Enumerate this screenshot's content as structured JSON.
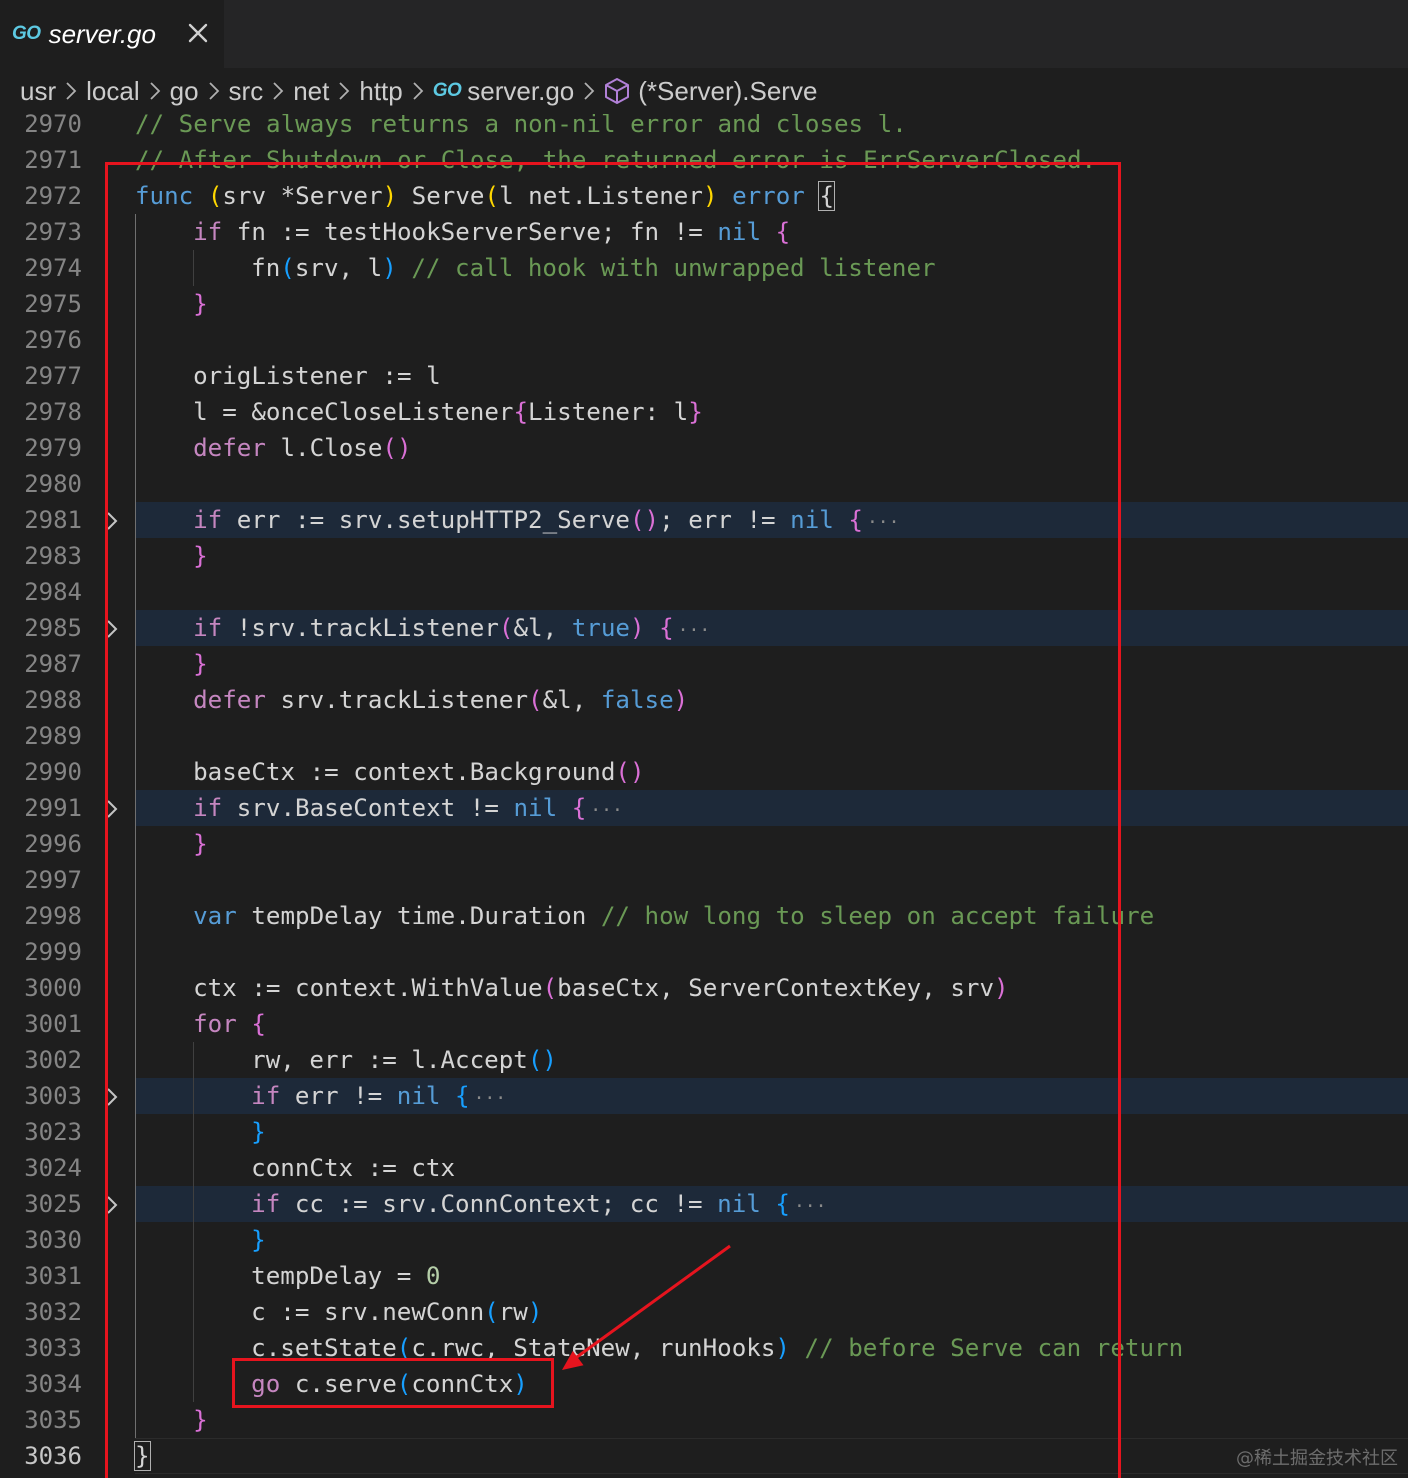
{
  "tab": {
    "badge": "GO",
    "title": "server.go",
    "close_icon": "close-icon"
  },
  "breadcrumb": {
    "segments": [
      "usr",
      "local",
      "go",
      "src",
      "net",
      "http",
      "server.go",
      "(*Server).Serve"
    ],
    "file_badge": "GO",
    "symbol_icon": "cube-method-icon"
  },
  "colors": {
    "comment": "#6a9955",
    "keyword": "#569cd6",
    "control": "#c586c0",
    "function": "#dcdcaa",
    "type": "#4ec9b0",
    "number": "#b5cea8",
    "bracket_1": "#ffd700",
    "bracket_2": "#da70d6",
    "bracket_3": "#179fff",
    "annotation_red": "#e6141e",
    "fold_highlight": "#1d2939"
  },
  "code_lines": [
    {
      "num": "2970",
      "indent": 0,
      "tokens": [
        [
          "// Serve always returns a non-nil error and closes l.",
          "cm"
        ]
      ]
    },
    {
      "num": "2971",
      "indent": 0,
      "tokens": [
        [
          "// After Shutdown or Close, the returned error is ErrServerClosed.",
          "cm"
        ]
      ]
    },
    {
      "num": "2972",
      "indent": 0,
      "tokens": [
        [
          "func",
          "kw"
        ],
        [
          " ",
          ""
        ],
        [
          "(",
          "b1"
        ],
        [
          "srv *Server",
          ""
        ],
        [
          ")",
          "b1"
        ],
        [
          " Serve",
          ""
        ],
        [
          "(",
          "b1"
        ],
        [
          "l net.Listener",
          ""
        ],
        [
          ")",
          "b1"
        ],
        [
          " ",
          ""
        ],
        [
          "error",
          "kw"
        ],
        [
          " ",
          ""
        ],
        [
          "{",
          "bm"
        ]
      ]
    },
    {
      "num": "2973",
      "indent": 1,
      "tokens": [
        [
          "if",
          "ct"
        ],
        [
          " fn := testHookServerServe; fn != ",
          ""
        ],
        [
          "nil",
          "kw"
        ],
        [
          " ",
          ""
        ],
        [
          "{",
          "b2"
        ]
      ]
    },
    {
      "num": "2974",
      "indent": 2,
      "tokens": [
        [
          "fn",
          ""
        ],
        [
          "(",
          "b3"
        ],
        [
          "srv, l",
          ""
        ],
        [
          ")",
          "b3"
        ],
        [
          " ",
          ""
        ],
        [
          "// call hook with unwrapped listener",
          "cm"
        ]
      ]
    },
    {
      "num": "2975",
      "indent": 1,
      "tokens": [
        [
          "}",
          "b2"
        ]
      ]
    },
    {
      "num": "2976",
      "indent": 0,
      "tokens": []
    },
    {
      "num": "2977",
      "indent": 1,
      "tokens": [
        [
          "origListener := l",
          ""
        ]
      ]
    },
    {
      "num": "2978",
      "indent": 1,
      "tokens": [
        [
          "l = &onceCloseListener",
          ""
        ],
        [
          "{",
          "b2"
        ],
        [
          "Listener: l",
          ""
        ],
        [
          "}",
          "b2"
        ]
      ]
    },
    {
      "num": "2979",
      "indent": 1,
      "tokens": [
        [
          "defer",
          "ct"
        ],
        [
          " l.Close",
          ""
        ],
        [
          "()",
          "b2"
        ]
      ]
    },
    {
      "num": "2980",
      "indent": 0,
      "tokens": []
    },
    {
      "num": "2981",
      "indent": 1,
      "folded": true,
      "tokens": [
        [
          "if",
          "ct"
        ],
        [
          " err := srv.setupHTTP2_Serve",
          ""
        ],
        [
          "()",
          "b2"
        ],
        [
          "; err != ",
          ""
        ],
        [
          "nil",
          "kw"
        ],
        [
          " ",
          ""
        ],
        [
          "{",
          "b2"
        ],
        [
          "···",
          "el"
        ]
      ]
    },
    {
      "num": "2983",
      "indent": 1,
      "tokens": [
        [
          "}",
          "b2"
        ]
      ]
    },
    {
      "num": "2984",
      "indent": 0,
      "tokens": []
    },
    {
      "num": "2985",
      "indent": 1,
      "folded": true,
      "tokens": [
        [
          "if",
          "ct"
        ],
        [
          " !srv.trackListener",
          ""
        ],
        [
          "(",
          "b2"
        ],
        [
          "&l, ",
          ""
        ],
        [
          "true",
          "kw"
        ],
        [
          ")",
          "b2"
        ],
        [
          " ",
          ""
        ],
        [
          "{",
          "b2"
        ],
        [
          "···",
          "el"
        ]
      ]
    },
    {
      "num": "2987",
      "indent": 1,
      "tokens": [
        [
          "}",
          "b2"
        ]
      ]
    },
    {
      "num": "2988",
      "indent": 1,
      "tokens": [
        [
          "defer",
          "ct"
        ],
        [
          " srv.trackListener",
          ""
        ],
        [
          "(",
          "b2"
        ],
        [
          "&l, ",
          ""
        ],
        [
          "false",
          "kw"
        ],
        [
          ")",
          "b2"
        ]
      ]
    },
    {
      "num": "2989",
      "indent": 0,
      "tokens": []
    },
    {
      "num": "2990",
      "indent": 1,
      "tokens": [
        [
          "baseCtx := context.Background",
          ""
        ],
        [
          "()",
          "b2"
        ]
      ]
    },
    {
      "num": "2991",
      "indent": 1,
      "folded": true,
      "tokens": [
        [
          "if",
          "ct"
        ],
        [
          " srv.BaseContext != ",
          ""
        ],
        [
          "nil",
          "kw"
        ],
        [
          " ",
          ""
        ],
        [
          "{",
          "b2"
        ],
        [
          "···",
          "el"
        ]
      ]
    },
    {
      "num": "2996",
      "indent": 1,
      "tokens": [
        [
          "}",
          "b2"
        ]
      ]
    },
    {
      "num": "2997",
      "indent": 0,
      "tokens": []
    },
    {
      "num": "2998",
      "indent": 1,
      "tokens": [
        [
          "var",
          "kw"
        ],
        [
          " tempDelay time.Duration ",
          ""
        ],
        [
          "// how long to sleep on accept failure",
          "cm"
        ]
      ]
    },
    {
      "num": "2999",
      "indent": 0,
      "tokens": []
    },
    {
      "num": "3000",
      "indent": 1,
      "tokens": [
        [
          "ctx := context.WithValue",
          ""
        ],
        [
          "(",
          "b2"
        ],
        [
          "baseCtx, ServerContextKey, srv",
          ""
        ],
        [
          ")",
          "b2"
        ]
      ]
    },
    {
      "num": "3001",
      "indent": 1,
      "tokens": [
        [
          "for",
          "ct"
        ],
        [
          " ",
          ""
        ],
        [
          "{",
          "b2"
        ]
      ]
    },
    {
      "num": "3002",
      "indent": 2,
      "tokens": [
        [
          "rw, err := l.Accept",
          ""
        ],
        [
          "()",
          "b3"
        ]
      ]
    },
    {
      "num": "3003",
      "indent": 2,
      "folded": true,
      "tokens": [
        [
          "if",
          "ct"
        ],
        [
          " err != ",
          ""
        ],
        [
          "nil",
          "kw"
        ],
        [
          " ",
          ""
        ],
        [
          "{",
          "b3"
        ],
        [
          "···",
          "el"
        ]
      ]
    },
    {
      "num": "3023",
      "indent": 2,
      "tokens": [
        [
          "}",
          "b3"
        ]
      ]
    },
    {
      "num": "3024",
      "indent": 2,
      "tokens": [
        [
          "connCtx := ctx",
          ""
        ]
      ]
    },
    {
      "num": "3025",
      "indent": 2,
      "folded": true,
      "tokens": [
        [
          "if",
          "ct"
        ],
        [
          " cc := srv.ConnContext; cc != ",
          ""
        ],
        [
          "nil",
          "kw"
        ],
        [
          " ",
          ""
        ],
        [
          "{",
          "b3"
        ],
        [
          "···",
          "el"
        ]
      ]
    },
    {
      "num": "3030",
      "indent": 2,
      "tokens": [
        [
          "}",
          "b3"
        ]
      ]
    },
    {
      "num": "3031",
      "indent": 2,
      "tokens": [
        [
          "tempDelay = ",
          ""
        ],
        [
          "0",
          "nm"
        ]
      ]
    },
    {
      "num": "3032",
      "indent": 2,
      "tokens": [
        [
          "c := srv.newConn",
          ""
        ],
        [
          "(",
          "b3"
        ],
        [
          "rw",
          ""
        ],
        [
          ")",
          "b3"
        ]
      ]
    },
    {
      "num": "3033",
      "indent": 2,
      "tokens": [
        [
          "c.setState",
          ""
        ],
        [
          "(",
          "b3"
        ],
        [
          "c.rwc, StateNew, runHooks",
          ""
        ],
        [
          ")",
          "b3"
        ],
        [
          " ",
          ""
        ],
        [
          "// before Serve can return",
          "cm"
        ]
      ]
    },
    {
      "num": "3034",
      "indent": 2,
      "tokens": [
        [
          "go",
          "ct"
        ],
        [
          " c.serve",
          ""
        ],
        [
          "(",
          "b3"
        ],
        [
          "connCtx",
          ""
        ],
        [
          ")",
          "b3"
        ]
      ]
    },
    {
      "num": "3035",
      "indent": 1,
      "tokens": [
        [
          "}",
          "b2"
        ]
      ]
    },
    {
      "num": "3036",
      "indent": 0,
      "active": true,
      "tokens": [
        [
          "}",
          "bm"
        ]
      ]
    }
  ],
  "annotation": {
    "box_color": "#e6141e"
  },
  "watermark": "@稀土掘金技术社区"
}
